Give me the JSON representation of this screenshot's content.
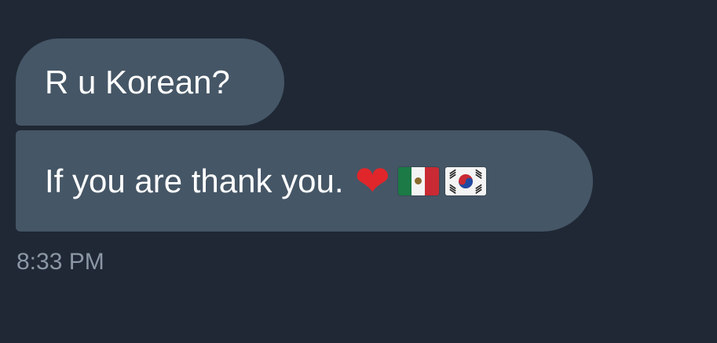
{
  "messages": [
    {
      "text": "R u Korean?"
    },
    {
      "text": "If you are thank you.",
      "emojis": [
        "red-heart",
        "flag-mexico",
        "flag-south-korea"
      ]
    }
  ],
  "timestamp": "8:33 PM",
  "colors": {
    "background": "#202835",
    "bubble": "#455666",
    "text": "#ffffff",
    "timestamp": "#8b97a5"
  }
}
